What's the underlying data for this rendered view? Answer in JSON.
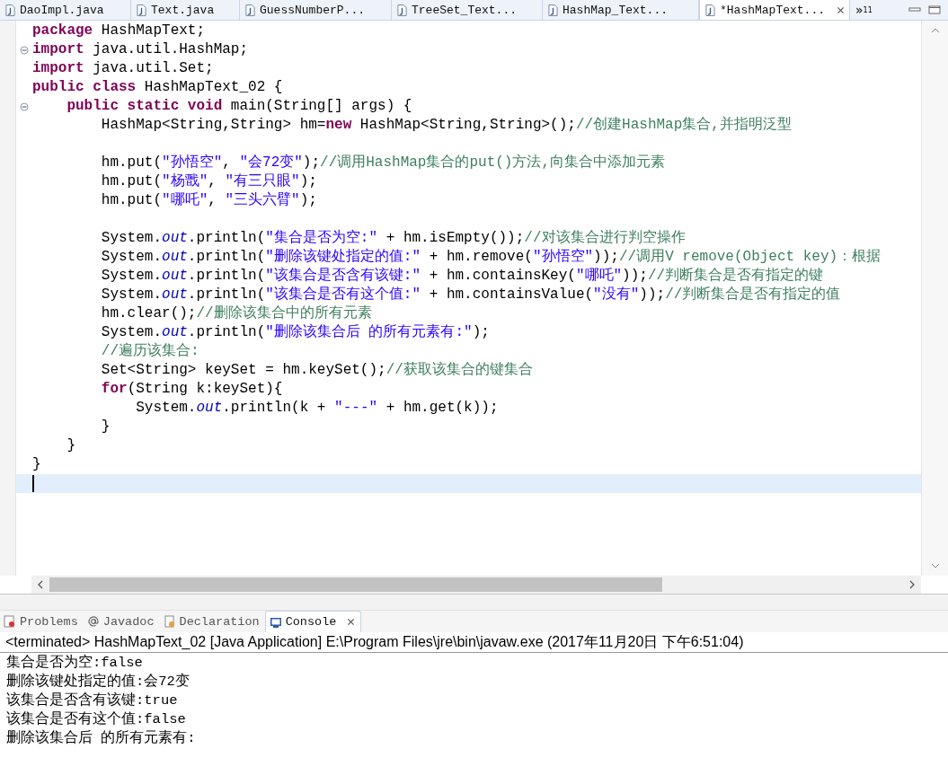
{
  "editor_tabs": [
    {
      "label": "DaoImpl.java",
      "selected": false
    },
    {
      "label": "Text.java",
      "selected": false
    },
    {
      "label": "GuessNumberP...",
      "selected": false
    },
    {
      "label": "TreeSet_Text...",
      "selected": false
    },
    {
      "label": "HashMap_Text...",
      "selected": false
    },
    {
      "label": "*HashMapText...",
      "selected": true
    }
  ],
  "overflow_tabs": {
    "symbol": "»",
    "count": "11"
  },
  "code_lines": [
    {
      "kind": "code",
      "fold": false,
      "current": false,
      "segs": [
        {
          "kind": "kw",
          "text": "package"
        },
        {
          "kind": "txt",
          "text": " HashMapText;"
        }
      ]
    },
    {
      "kind": "code",
      "fold": true,
      "current": false,
      "segs": [
        {
          "kind": "kw",
          "text": "import"
        },
        {
          "kind": "txt",
          "text": " java.util.HashMap;"
        }
      ]
    },
    {
      "kind": "code",
      "fold": false,
      "current": false,
      "segs": [
        {
          "kind": "kw",
          "text": "import"
        },
        {
          "kind": "txt",
          "text": " java.util.Set;"
        }
      ]
    },
    {
      "kind": "code",
      "fold": false,
      "current": false,
      "segs": [
        {
          "kind": "kw",
          "text": "public class"
        },
        {
          "kind": "txt",
          "text": " HashMapText_02 {"
        }
      ]
    },
    {
      "kind": "code",
      "fold": true,
      "current": false,
      "segs": [
        {
          "kind": "kw",
          "text": "    public static void"
        },
        {
          "kind": "txt",
          "text": " main(String[] args) {"
        }
      ]
    },
    {
      "kind": "code",
      "fold": false,
      "current": false,
      "segs": [
        {
          "kind": "txt",
          "text": "        HashMap<String,String> hm="
        },
        {
          "kind": "kw",
          "text": "new"
        },
        {
          "kind": "txt",
          "text": " HashMap<String,String>();"
        },
        {
          "kind": "com",
          "text": "//创建HashMap集合,并指明泛型"
        }
      ]
    },
    {
      "kind": "blank",
      "fold": false,
      "current": false
    },
    {
      "kind": "code",
      "fold": false,
      "current": false,
      "segs": [
        {
          "kind": "txt",
          "text": "        hm.put("
        },
        {
          "kind": "str",
          "text": "\"孙悟空\""
        },
        {
          "kind": "txt",
          "text": ", "
        },
        {
          "kind": "str",
          "text": "\"会72变\""
        },
        {
          "kind": "txt",
          "text": ");"
        },
        {
          "kind": "com",
          "text": "//调用HashMap集合的put()方法,向集合中添加元素"
        }
      ]
    },
    {
      "kind": "code",
      "fold": false,
      "current": false,
      "segs": [
        {
          "kind": "txt",
          "text": "        hm.put("
        },
        {
          "kind": "str",
          "text": "\"杨戬\""
        },
        {
          "kind": "txt",
          "text": ", "
        },
        {
          "kind": "str",
          "text": "\"有三只眼\""
        },
        {
          "kind": "txt",
          "text": ");"
        }
      ]
    },
    {
      "kind": "code",
      "fold": false,
      "current": false,
      "segs": [
        {
          "kind": "txt",
          "text": "        hm.put("
        },
        {
          "kind": "str",
          "text": "\"哪吒\""
        },
        {
          "kind": "txt",
          "text": ", "
        },
        {
          "kind": "str",
          "text": "\"三头六臂\""
        },
        {
          "kind": "txt",
          "text": ");"
        }
      ]
    },
    {
      "kind": "blank",
      "fold": false,
      "current": false
    },
    {
      "kind": "code",
      "fold": false,
      "current": false,
      "segs": [
        {
          "kind": "txt",
          "text": "        System."
        },
        {
          "kind": "fld",
          "text": "out"
        },
        {
          "kind": "txt",
          "text": ".println("
        },
        {
          "kind": "str",
          "text": "\"集合是否为空:\""
        },
        {
          "kind": "txt",
          "text": " + hm.isEmpty());"
        },
        {
          "kind": "com",
          "text": "//对该集合进行判空操作"
        }
      ]
    },
    {
      "kind": "code",
      "fold": false,
      "current": false,
      "segs": [
        {
          "kind": "txt",
          "text": "        System."
        },
        {
          "kind": "fld",
          "text": "out"
        },
        {
          "kind": "txt",
          "text": ".println("
        },
        {
          "kind": "str",
          "text": "\"删除该键处指定的值:\""
        },
        {
          "kind": "txt",
          "text": " + hm.remove("
        },
        {
          "kind": "str",
          "text": "\"孙悟空\""
        },
        {
          "kind": "txt",
          "text": "));"
        },
        {
          "kind": "com",
          "text": "//调用V remove(Object key)：根据"
        }
      ]
    },
    {
      "kind": "code",
      "fold": false,
      "current": false,
      "segs": [
        {
          "kind": "txt",
          "text": "        System."
        },
        {
          "kind": "fld",
          "text": "out"
        },
        {
          "kind": "txt",
          "text": ".println("
        },
        {
          "kind": "str",
          "text": "\"该集合是否含有该键:\""
        },
        {
          "kind": "txt",
          "text": " + hm.containsKey("
        },
        {
          "kind": "str",
          "text": "\"哪吒\""
        },
        {
          "kind": "txt",
          "text": "));"
        },
        {
          "kind": "com",
          "text": "//判断集合是否有指定的键"
        }
      ]
    },
    {
      "kind": "code",
      "fold": false,
      "current": false,
      "segs": [
        {
          "kind": "txt",
          "text": "        System."
        },
        {
          "kind": "fld",
          "text": "out"
        },
        {
          "kind": "txt",
          "text": ".println("
        },
        {
          "kind": "str",
          "text": "\"该集合是否有这个值:\""
        },
        {
          "kind": "txt",
          "text": " + hm.containsValue("
        },
        {
          "kind": "str",
          "text": "\"没有\""
        },
        {
          "kind": "txt",
          "text": "));"
        },
        {
          "kind": "com",
          "text": "//判断集合是否有指定的值"
        }
      ]
    },
    {
      "kind": "code",
      "fold": false,
      "current": false,
      "segs": [
        {
          "kind": "txt",
          "text": "        hm.clear();"
        },
        {
          "kind": "com",
          "text": "//删除该集合中的所有元素"
        }
      ]
    },
    {
      "kind": "code",
      "fold": false,
      "current": false,
      "segs": [
        {
          "kind": "txt",
          "text": "        System."
        },
        {
          "kind": "fld",
          "text": "out"
        },
        {
          "kind": "txt",
          "text": ".println("
        },
        {
          "kind": "str",
          "text": "\"删除该集合后 的所有元素有:\""
        },
        {
          "kind": "txt",
          "text": ");"
        }
      ]
    },
    {
      "kind": "code",
      "fold": false,
      "current": false,
      "segs": [
        {
          "kind": "com",
          "text": "        //遍历该集合:"
        }
      ]
    },
    {
      "kind": "code",
      "fold": false,
      "current": false,
      "segs": [
        {
          "kind": "txt",
          "text": "        Set<String> keySet = hm.keySet();"
        },
        {
          "kind": "com",
          "text": "//获取该集合的键集合"
        }
      ]
    },
    {
      "kind": "code",
      "fold": false,
      "current": false,
      "segs": [
        {
          "kind": "kw",
          "text": "        for"
        },
        {
          "kind": "txt",
          "text": "(String k:keySet){"
        }
      ]
    },
    {
      "kind": "code",
      "fold": false,
      "current": false,
      "segs": [
        {
          "kind": "txt",
          "text": "            System."
        },
        {
          "kind": "fld",
          "text": "out"
        },
        {
          "kind": "txt",
          "text": ".println(k + "
        },
        {
          "kind": "str",
          "text": "\"---\""
        },
        {
          "kind": "txt",
          "text": " + hm.get(k));"
        }
      ]
    },
    {
      "kind": "code",
      "fold": false,
      "current": false,
      "segs": [
        {
          "kind": "txt",
          "text": "        }"
        }
      ]
    },
    {
      "kind": "code",
      "fold": false,
      "current": false,
      "segs": [
        {
          "kind": "txt",
          "text": "    }"
        }
      ]
    },
    {
      "kind": "code",
      "fold": false,
      "current": false,
      "segs": [
        {
          "kind": "txt",
          "text": "}"
        }
      ]
    },
    {
      "kind": "blank",
      "fold": false,
      "current": true
    }
  ],
  "panel_tabs": [
    {
      "label": "Problems",
      "selected": false
    },
    {
      "label": "Javadoc",
      "selected": false
    },
    {
      "label": "Declaration",
      "selected": false
    },
    {
      "label": "Console",
      "selected": true
    }
  ],
  "console": {
    "header": "<terminated> HashMapText_02 [Java Application] E:\\Program Files\\jre\\bin\\javaw.exe (2017年11月20日 下午6:51:04)",
    "output": [
      "集合是否为空:false",
      "删除该键处指定的值:会72变",
      "该集合是否含有该键:true",
      "该集合是否有这个值:false",
      "删除该集合后 的所有元素有:"
    ]
  }
}
